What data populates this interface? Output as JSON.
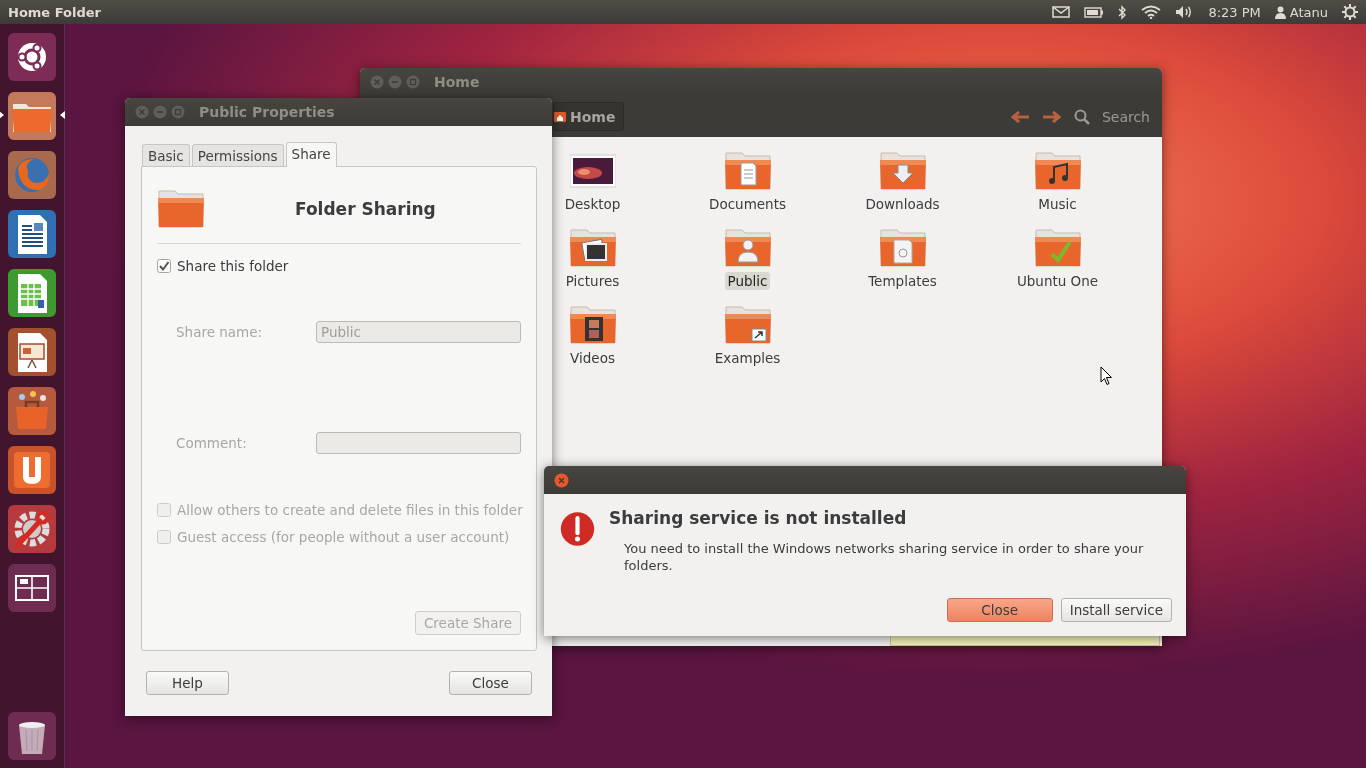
{
  "top_panel": {
    "title": "Home Folder",
    "clock": "8:23 PM",
    "user": "Atanu"
  },
  "launcher": {
    "items": [
      {
        "kind": "dash",
        "active": false
      },
      {
        "kind": "files",
        "active": true
      },
      {
        "kind": "browser",
        "active": false
      },
      {
        "kind": "writer",
        "active": false
      },
      {
        "kind": "calc",
        "active": false
      },
      {
        "kind": "impress",
        "active": false
      },
      {
        "kind": "software",
        "active": false
      },
      {
        "kind": "cloud",
        "active": false
      },
      {
        "kind": "settings",
        "active": false
      },
      {
        "kind": "workspaces",
        "active": false
      },
      {
        "kind": "trash",
        "active": false
      }
    ]
  },
  "file_manager": {
    "title": "Home",
    "location": "Home",
    "search": "Search",
    "items": [
      {
        "label": "Desktop",
        "kind": "desktop",
        "selected": false
      },
      {
        "label": "Documents",
        "kind": "documents",
        "selected": false
      },
      {
        "label": "Downloads",
        "kind": "downloads",
        "selected": false
      },
      {
        "label": "Music",
        "kind": "music",
        "selected": false
      },
      {
        "label": "Pictures",
        "kind": "pictures",
        "selected": false
      },
      {
        "label": "Public",
        "kind": "public",
        "selected": true
      },
      {
        "label": "Templates",
        "kind": "templates",
        "selected": false
      },
      {
        "label": "Ubuntu One",
        "kind": "cloud",
        "selected": false
      },
      {
        "label": "Videos",
        "kind": "videos",
        "selected": false
      },
      {
        "label": "Examples",
        "kind": "link",
        "selected": false
      }
    ]
  },
  "properties": {
    "title": "Public Properties",
    "tabs": [
      {
        "label": "Basic",
        "selected": false
      },
      {
        "label": "Permissions",
        "selected": false
      },
      {
        "label": "Share",
        "selected": true
      }
    ],
    "heading": "Folder Sharing",
    "share_folder": {
      "label": "Share this folder",
      "checked": true,
      "disabled": false
    },
    "share_name": {
      "label": "Share name:",
      "value": "Public",
      "disabled": true
    },
    "comment": {
      "label": "Comment:",
      "disabled": true
    },
    "options": [
      {
        "label": "Allow others to create and delete files in this folder",
        "checked": false,
        "disabled": true
      },
      {
        "label": "Guest access (for people without a user account)",
        "checked": false,
        "disabled": true
      }
    ],
    "create_button": {
      "label": "Create Share",
      "disabled": true
    },
    "buttons": [
      "Help",
      "Close"
    ]
  },
  "dialog": {
    "title": "Sharing service is not installed",
    "message": "You need to install the Windows networks sharing service in order to share your folders.",
    "buttons": [
      {
        "label": "Close",
        "kind": "default"
      },
      {
        "label": "Install service",
        "kind": "normal"
      }
    ]
  }
}
